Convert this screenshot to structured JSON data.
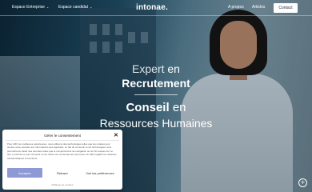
{
  "nav": {
    "items_left": [
      {
        "label": "Espace Entreprise"
      },
      {
        "label": "Espace candidat"
      }
    ],
    "logo": "intonae.",
    "items_right": [
      {
        "label": "A propos"
      },
      {
        "label": "Articles"
      }
    ],
    "contact_label": "Contact"
  },
  "hero": {
    "line1_light": "Expert ",
    "line1_rest": "en",
    "line2": "Recrutement",
    "line3_bold": "Conseil ",
    "line3_rest": "en",
    "line4": "Ressources Humaines"
  },
  "consent": {
    "title": "Gérer le consentement",
    "body": "Pour offrir les meilleures expériences, nous utilisons des technologies telles que les cookies pour stocker et/ou accéder aux informations des appareils. Le fait de consentir à ces technologies nous permettra de traiter des données telles que le comportement de navigation ou les ID uniques sur ce site. Le fait de ne pas consentir ou de retirer son consentement peut avoir un effet négatif sur certaines caractéristiques et fonctions.",
    "accept": "Accepter",
    "refuse": "Refuser",
    "prefs": "Voir les préférences",
    "footer": "Politique de cookies"
  },
  "icons": {
    "close": "close-icon",
    "plus": "plus-circle-icon"
  }
}
